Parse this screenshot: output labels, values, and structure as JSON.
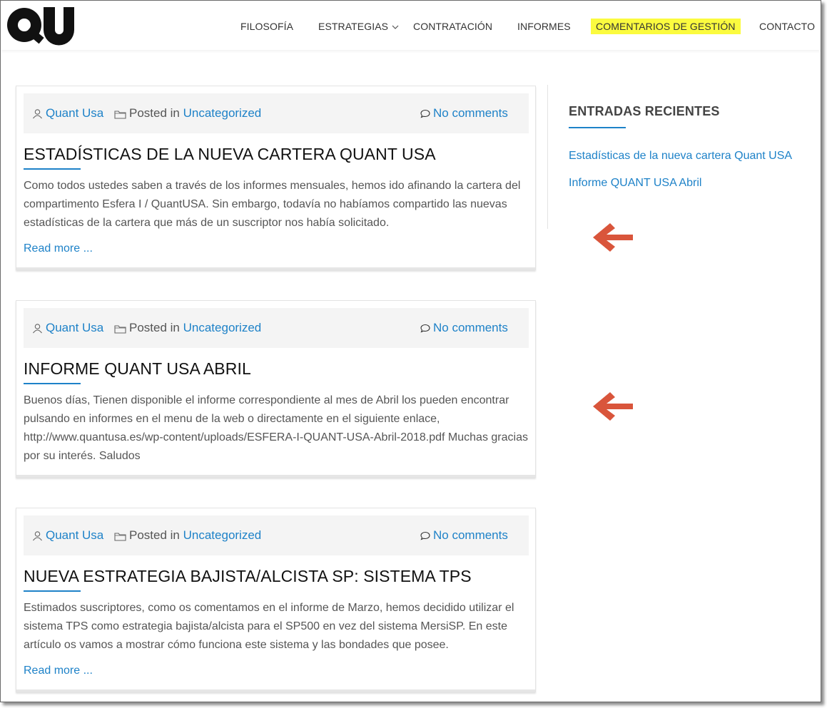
{
  "colors": {
    "accent": "#1e82c8",
    "highlight": "#fbfb3f",
    "arrow": "#d9553b"
  },
  "logo": {
    "text": "QU"
  },
  "nav": [
    {
      "label": "FILOSOFÍA"
    },
    {
      "label": "ESTRATEGIAS"
    },
    {
      "label": "CONTRATACIÓN"
    },
    {
      "label": "INFORMES"
    },
    {
      "label": "COMENTARIOS DE GESTIÓN"
    },
    {
      "label": "CONTACTO"
    }
  ],
  "posts": [
    {
      "author": "Quant Usa",
      "posted_in_label": "Posted in",
      "category": "Uncategorized",
      "comments": "No comments",
      "title": "ESTADÍSTICAS DE LA NUEVA CARTERA QUANT USA",
      "excerpt": "Como todos ustedes saben a través de los informes mensuales, hemos ido afinando la cartera del compartimento Esfera I / QuantUSA. Sin embargo, todavía no habíamos compartido las nuevas estadísticas de la cartera que más de un suscriptor nos había solicitado.",
      "read_more": "Read more ..."
    },
    {
      "author": "Quant Usa",
      "posted_in_label": "Posted in",
      "category": "Uncategorized",
      "comments": "No comments",
      "title": "INFORME QUANT USA ABRIL",
      "excerpt": "Buenos días, Tienen disponible el informe correspondiente al mes de Abril los pueden encontrar pulsando en informes en el menu de la web o directamente en el siguiente enlace, http://www.quantusa.es/wp-content/uploads/ESFERA-I-QUANT-USA-Abril-2018.pdf Muchas gracias por su interés. Saludos"
    },
    {
      "author": "Quant Usa",
      "posted_in_label": "Posted in",
      "category": "Uncategorized",
      "comments": "No comments",
      "title": "NUEVA ESTRATEGIA BAJISTA/ALCISTA SP: SISTEMA TPS",
      "excerpt": "Estimados suscriptores, como os comentamos en el informe de Marzo, hemos decidido utilizar el sistema TPS como estrategia bajista/alcista para el SP500 en vez del sistema MersiSP. En este artículo os vamos a mostrar cómo funciona este sistema y las bondades que posee.",
      "read_more": "Read more ..."
    }
  ],
  "sidebar": {
    "title": "ENTRADAS RECIENTES",
    "items": [
      {
        "label": "Estadísticas de la nueva cartera Quant USA"
      },
      {
        "label": "Informe QUANT USA Abril"
      }
    ]
  }
}
